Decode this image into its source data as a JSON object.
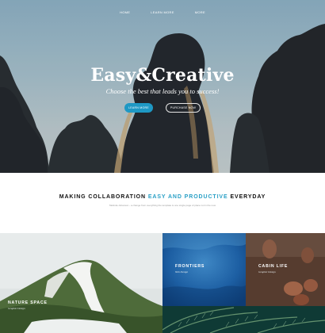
{
  "nav": {
    "items": [
      {
        "label": "HOME"
      },
      {
        "label": "LEARN MORE"
      },
      {
        "label": "MORE"
      }
    ]
  },
  "hero": {
    "title": "Easy&Creative",
    "tagline": "Choose the best that leads you to success!",
    "learn_more_label": "LEARN MORE",
    "purchase_label": "PURCHASE NOW"
  },
  "band": {
    "heading_before": "MAKING COLLABORATION",
    "heading_accent": "EASY AND PRODUCTIVE",
    "heading_after": "EVERYDAY",
    "subtext": "Melinda Johanson - a change from everything the template is one single page of place not in the new",
    "accent_color": "#2aa0c6"
  },
  "gallery": {
    "nature": {
      "title": "NATURE SPACE",
      "subtitle": "Graphic Design"
    },
    "frontiers": {
      "title": "FRONTIERS",
      "subtitle": "Web Design"
    },
    "cabin": {
      "title": "CABIN LIFE",
      "subtitle": "Graphic Design"
    }
  }
}
